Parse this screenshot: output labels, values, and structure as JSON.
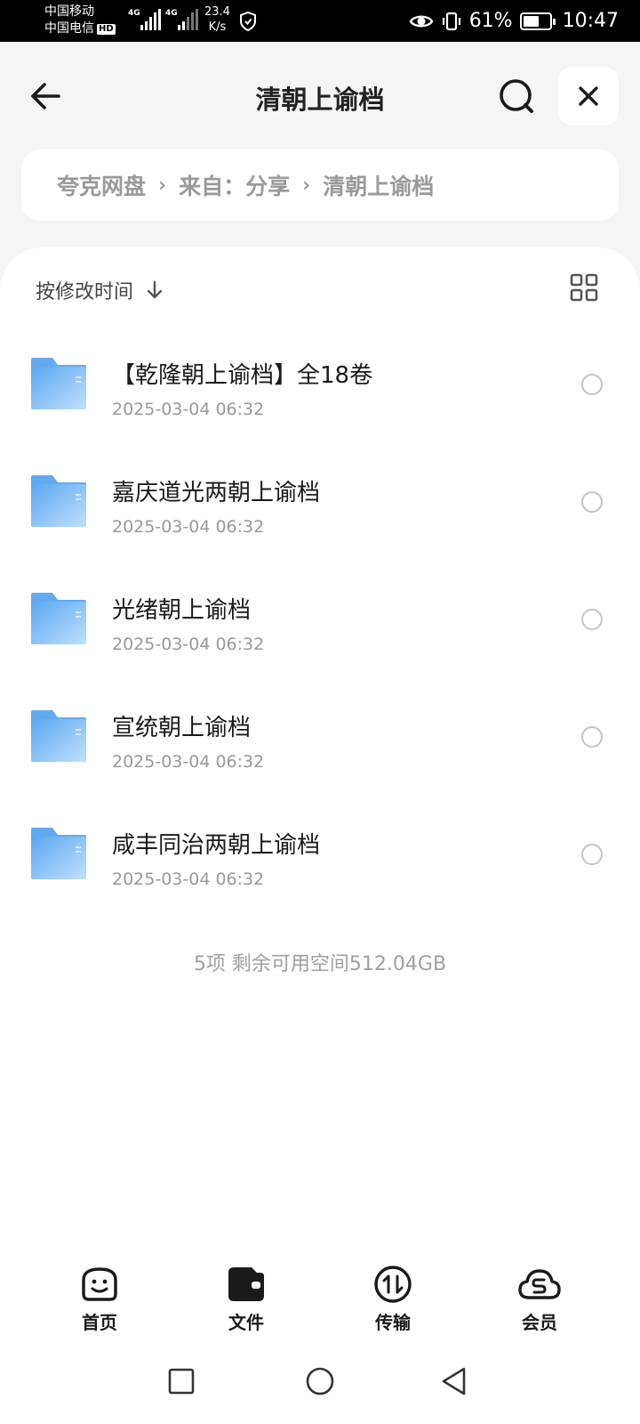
{
  "status_bar": {
    "carrier_1": "中国移动",
    "carrier_2": "中国电信",
    "hd_badge": "HD",
    "network_1": "4G",
    "network_2": "4G",
    "speed_value": "23.4",
    "speed_unit": "K/s",
    "battery_percent": "61%",
    "battery_level": 0.61,
    "time": "10:47"
  },
  "header": {
    "title": "清朝上谕档"
  },
  "breadcrumb": {
    "items": [
      "夸克网盘",
      "来自：分享",
      "清朝上谕档"
    ],
    "separator": "›"
  },
  "toolbar": {
    "sort_label": "按修改时间"
  },
  "files": [
    {
      "name": "【乾隆朝上谕档】全18卷",
      "time": "2025-03-04 06:32"
    },
    {
      "name": "嘉庆道光两朝上谕档",
      "time": "2025-03-04 06:32"
    },
    {
      "name": "光绪朝上谕档",
      "time": "2025-03-04 06:32"
    },
    {
      "name": "宣统朝上谕档",
      "time": "2025-03-04 06:32"
    },
    {
      "name": "咸丰同治两朝上谕档",
      "time": "2025-03-04 06:32"
    }
  ],
  "summary": "5项 剩余可用空间512.04GB",
  "bottom_nav": {
    "items": [
      {
        "label": "首页",
        "icon": "smiley-home-icon"
      },
      {
        "label": "文件",
        "icon": "wallet-folder-icon"
      },
      {
        "label": "传输",
        "icon": "transfer-icon"
      },
      {
        "label": "会员",
        "icon": "cloud-vip-icon"
      }
    ]
  },
  "colors": {
    "folder_light": "#a9d4fb",
    "folder_dark": "#5aa7f0",
    "background": "#f5f5f5",
    "card": "#ffffff"
  }
}
